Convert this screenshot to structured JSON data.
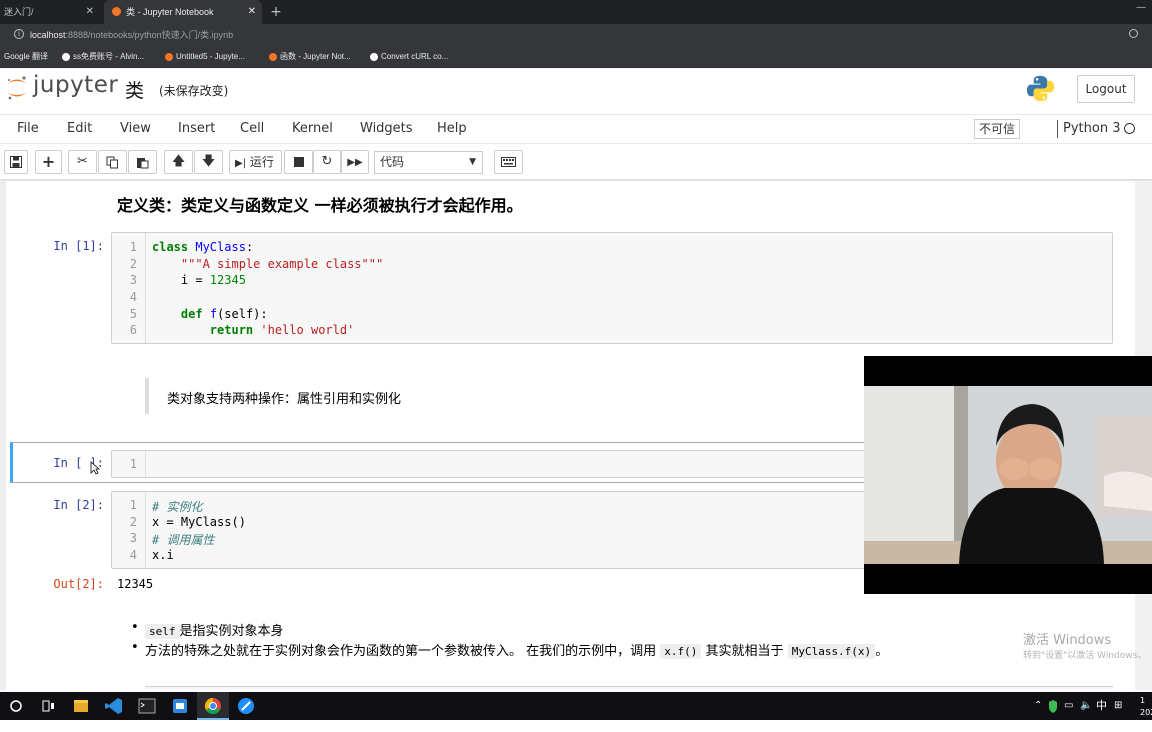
{
  "browser": {
    "tabs": [
      {
        "title": "迷入门/",
        "close": "✕"
      },
      {
        "title": "类 - Jupyter Notebook",
        "close": "✕"
      }
    ],
    "new_tab": "+",
    "url_host": "localhost",
    "url_path": ":8888/notebooks/python快速入门/类.ipynb",
    "bookmarks": [
      "Google 翻译",
      "ss免费账号 - Alvin...",
      "Untitled5 - Jupyte...",
      "函数 - Jupyter Not...",
      "Convert cURL co..."
    ]
  },
  "jupyter": {
    "logo_text": "jupyter",
    "notebook_name": "类",
    "save_status": "(未保存改变)",
    "logout": "Logout",
    "menu": [
      "File",
      "Edit",
      "View",
      "Insert",
      "Cell",
      "Kernel",
      "Widgets",
      "Help"
    ],
    "trust": "不可信",
    "kernel_name": "Python 3",
    "toolbar": {
      "run_label": "运行",
      "cell_type": "代码"
    }
  },
  "notebook": {
    "heading": "定义类：类定义与函数定义 一样必须被执行才会起作用。",
    "cell1": {
      "prompt": "In  [1]:",
      "line_numbers": [
        "1",
        "2",
        "3",
        "4",
        "5",
        "6"
      ]
    },
    "markdown1": "类对象支持两种操作：属性引用和实例化",
    "cell_empty": {
      "prompt": "In  [ ]:",
      "line_numbers": [
        "1"
      ]
    },
    "cell2": {
      "prompt": "In  [2]:",
      "line_numbers": [
        "1",
        "2",
        "3",
        "4"
      ],
      "out_prompt": "Out[2]:",
      "output": "12345"
    },
    "bullets": {
      "b1_code": "self",
      "b1_text": "是指实例对象本身",
      "b2_text_a": "方法的特殊之处就在于实例对象会作为函数的第一个参数被传入。 在我们的示例中，调用",
      "b2_code_a": "x.f()",
      "b2_text_b": "其实就相当于",
      "b2_code_b": "MyClass.f(x)",
      "b2_text_c": "。"
    }
  },
  "windows": {
    "watermark_title": "激活 Windows",
    "watermark_sub": "转到\"设置\"以激活 Windows。",
    "tray_lang": "中",
    "colors": {
      "taskbar": "#101014",
      "accent": "#76b9ed"
    }
  },
  "colors": {
    "prompt_in": "#303f9f",
    "prompt_out": "#d84315",
    "selected_cell_border": "#42a5f5"
  }
}
